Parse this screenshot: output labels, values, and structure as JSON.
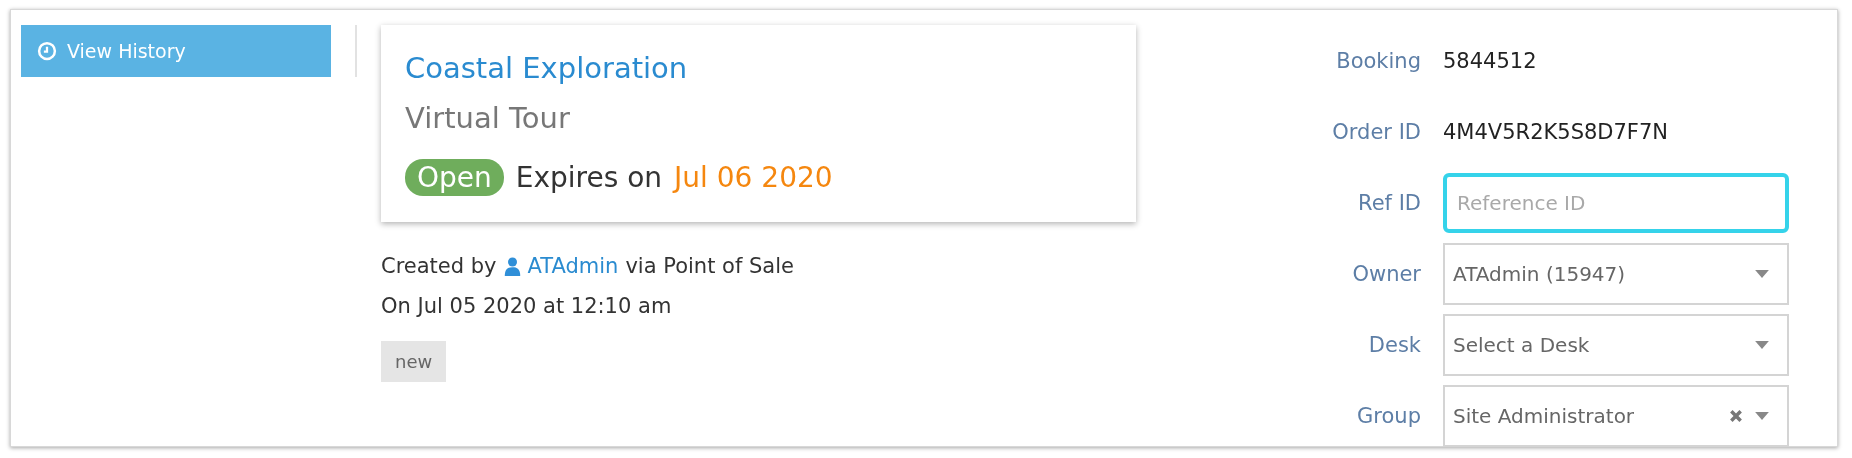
{
  "history_button": {
    "label": "View History"
  },
  "booking_card": {
    "title": "Coastal Exploration",
    "subtitle": "Virtual Tour",
    "status": "Open",
    "expires_label": "Expires on",
    "expires_date": "Jul 06 2020"
  },
  "created": {
    "prefix": "Created by",
    "user": "ATAdmin",
    "suffix": "via Point of Sale",
    "date_line": "On Jul 05 2020 at 12:10 am"
  },
  "tags": [
    "new"
  ],
  "fields": [
    {
      "kind": "text",
      "label": "Booking",
      "value": "5844512"
    },
    {
      "kind": "text",
      "label": "Order ID",
      "value": "4M4V5R2K5S8D7F7N"
    },
    {
      "kind": "input",
      "label": "Ref ID",
      "placeholder": "Reference ID",
      "focused": true
    },
    {
      "kind": "select",
      "label": "Owner",
      "value": "ATAdmin (15947)",
      "clearable": false
    },
    {
      "kind": "select",
      "label": "Desk",
      "value": "Select a Desk",
      "clearable": false
    },
    {
      "kind": "select",
      "label": "Group",
      "value": "Site Administrator",
      "clearable": true
    }
  ]
}
